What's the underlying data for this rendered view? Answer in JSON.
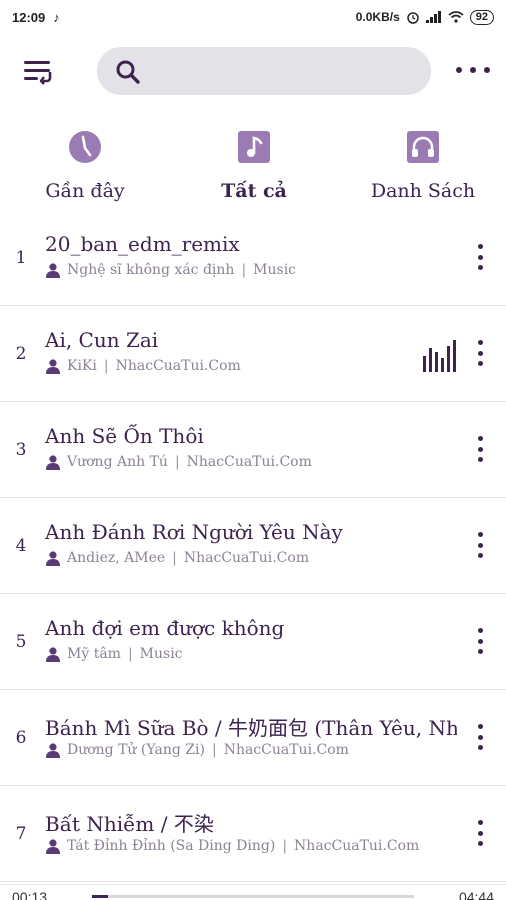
{
  "status_bar": {
    "time": "12:09",
    "music_icon": "music-note-icon",
    "speed": "0.0KB/s",
    "battery": "92"
  },
  "search": {
    "placeholder": ""
  },
  "tabs": [
    {
      "label": "Gần đây",
      "icon": "clock-icon",
      "active": false
    },
    {
      "label": "Tất cả",
      "icon": "music-note-icon",
      "active": true
    },
    {
      "label": "Danh Sách",
      "icon": "headphones-icon",
      "active": false
    }
  ],
  "songs": [
    {
      "index": "1",
      "title": "20_ban_edm_remix",
      "artist": "Nghệ sĩ không xác định",
      "source": "Music"
    },
    {
      "index": "2",
      "title": "Ai, Cun Zai",
      "artist": "KiKi",
      "source": "NhacCuaTui.Com",
      "playing": true
    },
    {
      "index": "3",
      "title": "Anh Sẽ Ổn Thôi",
      "artist": "Vương Anh Tú",
      "source": "NhacCuaTui.Com"
    },
    {
      "index": "4",
      "title": "Anh Đánh Rơi Người Yêu Này",
      "artist": "Andiez, AMee",
      "source": "NhacCuaTui.Com"
    },
    {
      "index": "5",
      "title": "Anh đợi em được không",
      "artist": "Mỹ tâm",
      "source": "Music"
    },
    {
      "index": "6",
      "title": "Bánh Mì Sữa Bò / 牛奶面包 (Thân Yêu, Nh",
      "artist": "Dương Tử (Yang Zi)",
      "source": "NhacCuaTui.Com"
    },
    {
      "index": "7",
      "title": "Bất Nhiễm / 不染",
      "artist": "Tát Đỉnh Đỉnh (Sa Ding Ding)",
      "source": "NhacCuaTui.Com"
    }
  ],
  "player": {
    "current_time": "00:13",
    "total_time": "04:44",
    "progress": 0.05
  },
  "colors": {
    "accent": "#3d2350",
    "icon_fill": "#9a7bb3",
    "search_bg": "#e4e1e8"
  }
}
